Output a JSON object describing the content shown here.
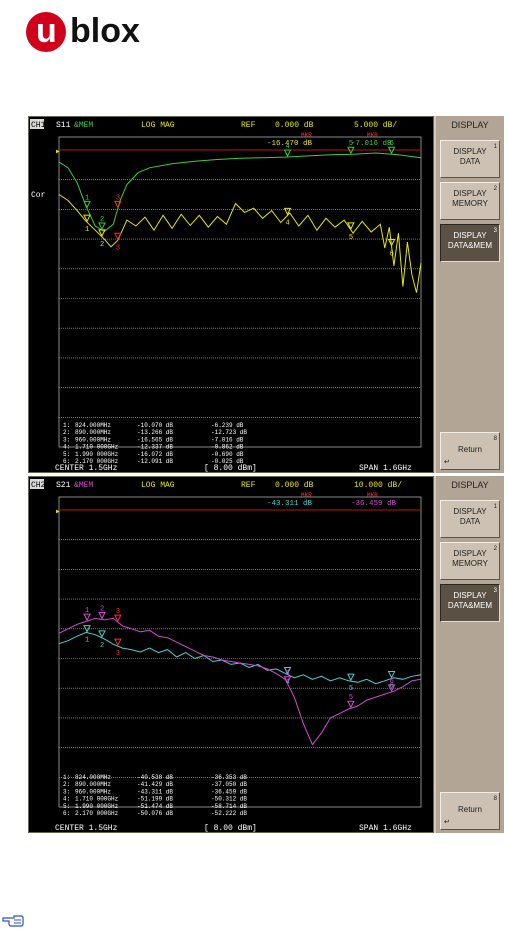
{
  "logo": {
    "first_letter": "u",
    "rest": "blox"
  },
  "colors": {
    "grid": "#b8b8b8",
    "ref_line": "#b01818",
    "header_yellow": "#e6e600",
    "s11_data": "#e8e800",
    "s11_mem": "#3ecb3e",
    "s21_data": "#4ad0d0",
    "s21_mem": "#d24ad2",
    "marker_ref": "#ff3030",
    "label_white": "#ffffff"
  },
  "icons": {
    "note": "pointing-hand-icon",
    "return": "return-arrow-icon"
  },
  "chart_data": [
    {
      "type": "line",
      "channel": "CH1",
      "param": "S11",
      "display_mode": "&MEM",
      "format": "LOG MAG",
      "ref_label": "REF",
      "ref_value": "0.000 dB",
      "scale": "5.000 dB/",
      "side_marker_readout": {
        "label": "MKR",
        "value1": "-16.470 dB",
        "value2": "-7.016 dB"
      },
      "status_left": "Cor",
      "center": "CENTER 1.5GHz",
      "power": "[ 8.00 dBm]",
      "span": "SPAN 1.6GHz",
      "x_range": [
        0.7,
        2.3
      ],
      "y_range": [
        -50,
        0
      ],
      "ref_level": 0,
      "divisions": 10,
      "series": [
        {
          "role": "memory",
          "x": [
            0.7,
            0.74,
            0.78,
            0.82,
            0.86,
            0.9,
            0.94,
            0.97,
            1.0,
            1.05,
            1.1,
            1.2,
            1.3,
            1.4,
            1.5,
            1.6,
            1.7,
            1.8,
            1.9,
            2.0,
            2.1,
            2.2,
            2.3
          ],
          "y": [
            -2.0,
            -3.0,
            -5.5,
            -9.5,
            -12.8,
            -13.7,
            -12.5,
            -8.5,
            -5.8,
            -3.8,
            -3.0,
            -2.3,
            -1.9,
            -1.6,
            -1.4,
            -1.3,
            -1.2,
            -1.0,
            -0.8,
            -0.7,
            -0.5,
            -0.8,
            -1.3
          ]
        },
        {
          "role": "data",
          "x": [
            0.7,
            0.74,
            0.78,
            0.82,
            0.86,
            0.9,
            0.93,
            0.96,
            1.0,
            1.04,
            1.08,
            1.12,
            1.16,
            1.2,
            1.24,
            1.28,
            1.32,
            1.36,
            1.4,
            1.44,
            1.48,
            1.52,
            1.56,
            1.6,
            1.64,
            1.68,
            1.72,
            1.76,
            1.8,
            1.84,
            1.88,
            1.92,
            1.96,
            2.0,
            2.04,
            2.08,
            2.12,
            2.14,
            2.16,
            2.18,
            2.2,
            2.22,
            2.24,
            2.26,
            2.28,
            2.3
          ],
          "y": [
            -7.5,
            -8.5,
            -10.2,
            -12.0,
            -13.5,
            -15.0,
            -16.3,
            -15.2,
            -11.8,
            -12.8,
            -11.3,
            -13.5,
            -11.0,
            -13.2,
            -10.8,
            -12.7,
            -11.0,
            -13.0,
            -11.2,
            -12.5,
            -9.0,
            -10.5,
            -9.8,
            -11.5,
            -10.2,
            -12.2,
            -10.6,
            -12.8,
            -11.0,
            -13.5,
            -11.5,
            -13.0,
            -11.8,
            -14.0,
            -12.0,
            -13.8,
            -12.5,
            -16.5,
            -13.0,
            -19.5,
            -14.0,
            -23.0,
            -15.5,
            -21.0,
            -24.0,
            -19.0
          ]
        }
      ],
      "markers_data": [
        {
          "id": "1",
          "x": 0.824
        },
        {
          "id": "2",
          "x": 0.89
        },
        {
          "id": "3",
          "x": 0.96,
          "reference": true
        },
        {
          "id": "4",
          "x": 1.71
        },
        {
          "id": "5",
          "x": 1.99
        },
        {
          "id": "6",
          "x": 2.17
        }
      ],
      "markers_memory": [
        {
          "id": "1",
          "x": 0.824
        },
        {
          "id": "2",
          "x": 0.89
        },
        {
          "id": "3",
          "x": 0.96,
          "reference": true
        },
        {
          "id": "4",
          "x": 1.71
        },
        {
          "id": "5",
          "x": 1.99
        },
        {
          "id": "6",
          "x": 2.17
        }
      ],
      "marker_table": [
        {
          "label": "1:",
          "freq": "824.000MHz",
          "v1": "-10.070 dB",
          "v2": "-6.239 dB"
        },
        {
          "label": "2:",
          "freq": "890.000MHz",
          "v1": "-13.266 dB",
          "v2": "-12.723 dB"
        },
        {
          "label": "3:",
          "freq": "960.000MHz",
          "v1": "-16.565 dB",
          "v2": "-7.016 dB"
        },
        {
          "label": "4:",
          "freq": "1.710 000GHz",
          "v1": "-12.337 dB",
          "v2": "-0.862 dB"
        },
        {
          "label": "5:",
          "freq": "1.990 000GHz",
          "v1": "-16.072 dB",
          "v2": "-0.690 dB"
        },
        {
          "label": "6:",
          "freq": "2.170 000GHz",
          "v1": "-12.091 dB",
          "v2": "-0.025 dB"
        }
      ]
    },
    {
      "type": "line",
      "channel": "CH2",
      "param": "S21",
      "display_mode": "&MEM",
      "format": "LOG MAG",
      "ref_label": "REF",
      "ref_value": "0.000 dB",
      "scale": "10.000 dB/",
      "side_marker_readout": {
        "label": "MKR",
        "value1": "-43.311 dB",
        "value2": "-36.459 dB"
      },
      "status_left": "",
      "center": "CENTER 1.5GHz",
      "power": "[ 8.00 dBm]",
      "span": "SPAN 1.6GHz",
      "x_range": [
        0.7,
        2.3
      ],
      "y_range": [
        -100,
        0
      ],
      "ref_level": 0,
      "divisions": 10,
      "series": [
        {
          "role": "data",
          "x": [
            0.7,
            0.74,
            0.78,
            0.82,
            0.86,
            0.9,
            0.94,
            0.98,
            1.02,
            1.06,
            1.1,
            1.14,
            1.18,
            1.22,
            1.26,
            1.3,
            1.34,
            1.38,
            1.42,
            1.46,
            1.5,
            1.54,
            1.58,
            1.62,
            1.66,
            1.7,
            1.74,
            1.78,
            1.82,
            1.86,
            1.9,
            1.94,
            1.98,
            2.02,
            2.06,
            2.1,
            2.14,
            2.18,
            2.22,
            2.26,
            2.3
          ],
          "y": [
            -45.0,
            -44.0,
            -42.5,
            -41.2,
            -42.0,
            -43.4,
            -45.2,
            -46.5,
            -47.0,
            -47.8,
            -46.5,
            -48.0,
            -47.0,
            -49.5,
            -48.0,
            -50.0,
            -49.0,
            -51.0,
            -50.5,
            -52.0,
            -51.5,
            -53.0,
            -52.0,
            -54.0,
            -53.5,
            -55.0,
            -56.5,
            -55.5,
            -57.0,
            -56.0,
            -57.5,
            -56.5,
            -57.5,
            -58.0,
            -57.0,
            -58.5,
            -57.5,
            -56.5,
            -57.0,
            -56.0,
            -55.5
          ]
        },
        {
          "role": "memory",
          "x": [
            0.7,
            0.74,
            0.78,
            0.82,
            0.86,
            0.9,
            0.94,
            0.98,
            1.02,
            1.06,
            1.1,
            1.14,
            1.18,
            1.22,
            1.26,
            1.3,
            1.34,
            1.38,
            1.42,
            1.46,
            1.5,
            1.54,
            1.58,
            1.62,
            1.66,
            1.7,
            1.74,
            1.78,
            1.82,
            1.86,
            1.9,
            1.94,
            1.98,
            2.02,
            2.06,
            2.1,
            2.14,
            2.18,
            2.22,
            2.26,
            2.3
          ],
          "y": [
            -41.5,
            -40.0,
            -38.5,
            -37.5,
            -36.5,
            -37.0,
            -36.5,
            -39.0,
            -40.0,
            -41.0,
            -40.5,
            -42.5,
            -43.0,
            -44.5,
            -46.0,
            -47.5,
            -49.0,
            -49.5,
            -50.5,
            -51.0,
            -51.5,
            -52.0,
            -52.5,
            -53.5,
            -55.0,
            -57.0,
            -63.0,
            -72.0,
            -79.0,
            -75.0,
            -70.0,
            -68.5,
            -67.0,
            -66.0,
            -64.0,
            -63.0,
            -62.0,
            -61.0,
            -59.5,
            -57.5,
            -57.0
          ]
        }
      ],
      "markers_data": [
        {
          "id": "1",
          "x": 0.824
        },
        {
          "id": "2",
          "x": 0.89
        },
        {
          "id": "3",
          "x": 0.96,
          "reference": true
        },
        {
          "id": "4",
          "x": 1.71
        },
        {
          "id": "5",
          "x": 1.99
        },
        {
          "id": "6",
          "x": 2.17
        }
      ],
      "markers_memory": [
        {
          "id": "1",
          "x": 0.824
        },
        {
          "id": "2",
          "x": 0.89
        },
        {
          "id": "3",
          "x": 0.96,
          "reference": true
        },
        {
          "id": "4",
          "x": 1.71
        },
        {
          "id": "5",
          "x": 1.99
        },
        {
          "id": "6",
          "x": 2.17
        }
      ],
      "marker_table": [
        {
          "label": "1:",
          "freq": "824.000MHz",
          "v1": "-40.538 dB",
          "v2": "-36.353 dB"
        },
        {
          "label": "2:",
          "freq": "890.000MHz",
          "v1": "-41.429 dB",
          "v2": "-37.050 dB"
        },
        {
          "label": "3:",
          "freq": "960.000MHz",
          "v1": "-43.311 dB",
          "v2": "-36.459 dB"
        },
        {
          "label": "4:",
          "freq": "1.710 000GHz",
          "v1": "-51.199 dB",
          "v2": "-50.312 dB"
        },
        {
          "label": "5:",
          "freq": "1.990 000GHz",
          "v1": "-51.474 dB",
          "v2": "-58.714 dB"
        },
        {
          "label": "6:",
          "freq": "2.170 000GHz",
          "v1": "-50.076 dB",
          "v2": "-52.222 dB"
        }
      ]
    }
  ],
  "softkeys": [
    {
      "title": "DISPLAY",
      "keys": [
        {
          "line1": "DISPLAY",
          "line2": "DATA",
          "num": "1"
        },
        {
          "line1": "DISPLAY",
          "line2": "MEMORY",
          "num": "2"
        },
        {
          "line1": "DISPLAY",
          "line2": "DATA&MEM",
          "num": "3"
        }
      ],
      "return_label": "Return",
      "return_num": "8"
    },
    {
      "title": "DISPLAY",
      "keys": [
        {
          "line1": "DISPLAY",
          "line2": "DATA",
          "num": "1"
        },
        {
          "line1": "DISPLAY",
          "line2": "MEMORY",
          "num": "2"
        },
        {
          "line1": "DISPLAY",
          "line2": "DATA&MEM",
          "num": "3"
        }
      ],
      "return_label": "Return",
      "return_num": "8"
    }
  ]
}
